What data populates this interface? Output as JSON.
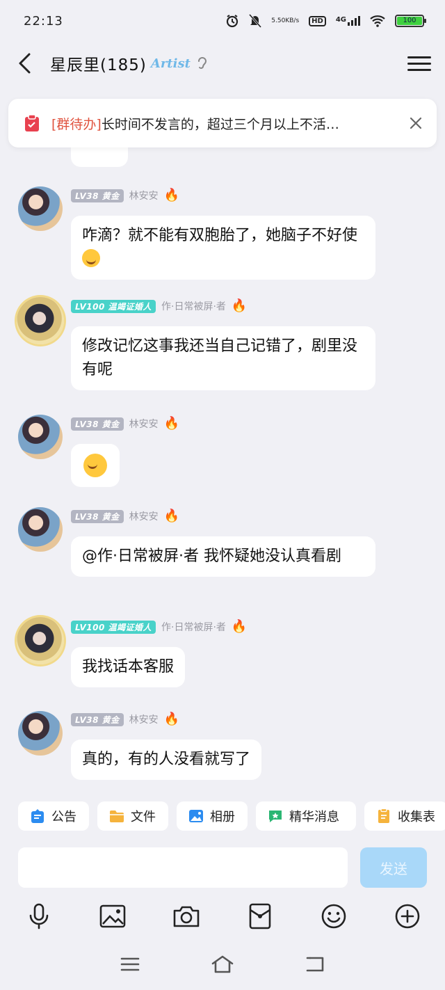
{
  "status_bar": {
    "time": "22:13",
    "net_speed_value": "5.50",
    "net_speed_unit": "KB/s",
    "hd_label": "HD",
    "network_label": "4G",
    "battery_level": "100",
    "battery_color": "#3fd03f"
  },
  "header": {
    "title": "星辰里(185)",
    "badge_text": "Artist"
  },
  "notice": {
    "tag": "[群待办]",
    "text": "长时间不发言的，超过三个月以上不活…"
  },
  "messages": [
    {
      "level": "LV38 黄金",
      "nickname": "林安安",
      "text": "咋滴？就不能有双胞胎了，她脑子不好使"
    },
    {
      "level": "LV100 温竭证婚人",
      "nickname": "作·日常被屏·者",
      "text": "修改记忆这事我还当自己记错了，剧里没有呢"
    },
    {
      "level": "LV38 黄金",
      "nickname": "林安安",
      "text": ""
    },
    {
      "level": "LV38 黄金",
      "nickname": "林安安",
      "text": "@作·日常被屏·者 我怀疑她没认真看剧"
    },
    {
      "level": "LV100 温竭证婚人",
      "nickname": "作·日常被屏·者",
      "text": "我找话本客服"
    },
    {
      "level": "LV38 黄金",
      "nickname": "林安安",
      "text": "真的，有的人没看就写了"
    }
  ],
  "quick_actions": [
    {
      "label": "公告",
      "icon": "announcement-icon"
    },
    {
      "label": "文件",
      "icon": "folder-icon"
    },
    {
      "label": "相册",
      "icon": "album-icon"
    },
    {
      "label": "精华消息",
      "icon": "featured-message-icon"
    },
    {
      "label": "收集表",
      "icon": "form-icon"
    }
  ],
  "composer": {
    "placeholder": "",
    "send_label": "发送"
  },
  "colors": {
    "accent_blue": "#a9d8f9",
    "level_gray": "#b3b5c2",
    "level_teal": "#49d2c9",
    "notice_tag": "#e0533f"
  }
}
